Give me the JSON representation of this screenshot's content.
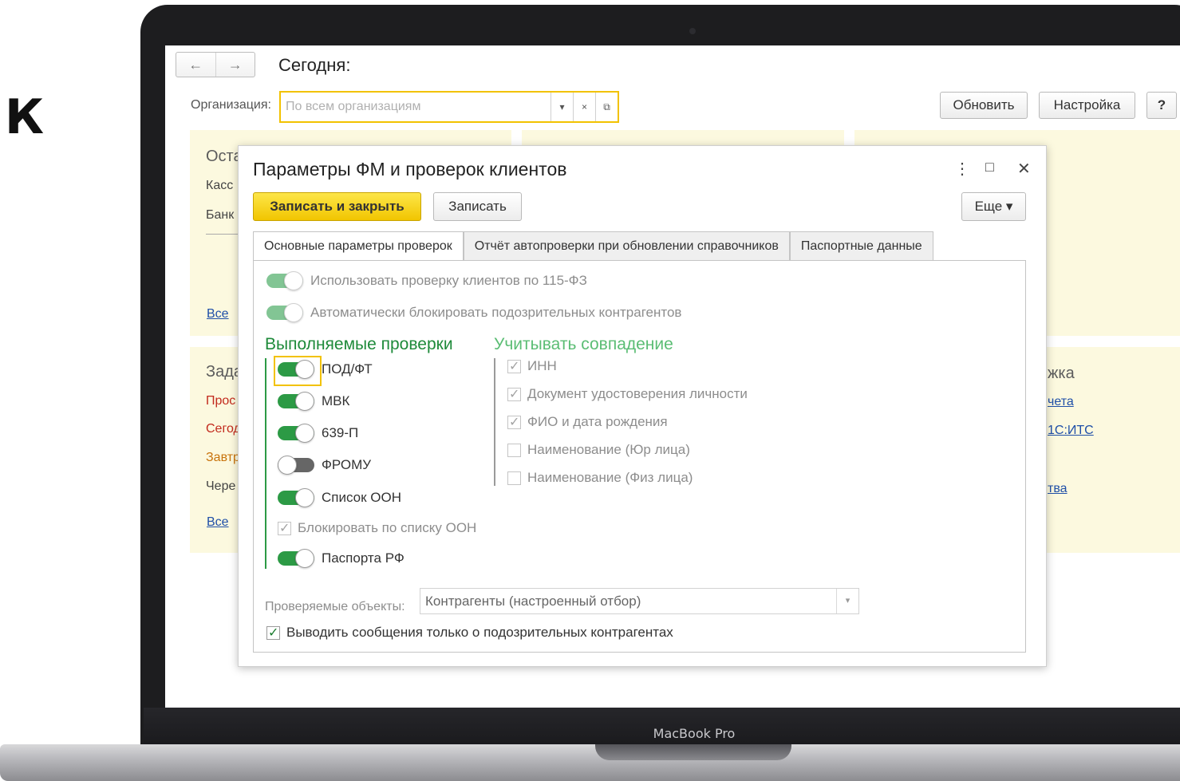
{
  "side_text": "К",
  "device_label": "MacBook Pro",
  "app": {
    "title": "Сегодня:",
    "nav_back": "←",
    "nav_forward": "→",
    "org_label": "Организация:",
    "org_placeholder": "По всем организациям",
    "org_dropdown_glyph": "▾",
    "org_clear_glyph": "×",
    "org_open_glyph": "⧉",
    "refresh_button": "Обновить",
    "settings_button": "Настройка",
    "help_button": "?"
  },
  "background": {
    "left_panel": {
      "heading": "Оста",
      "lines": [
        "Касс",
        "Банк"
      ],
      "link": "Все"
    },
    "tasks_panel": {
      "heading": "Зада",
      "lines": [
        "Прос",
        "Сегод",
        "Завтр",
        "Чере"
      ],
      "link": "Все"
    },
    "right_panel": {
      "heading": "жка",
      "links": [
        "чета",
        "1С:ИТС",
        "тва"
      ]
    }
  },
  "dialog": {
    "title": "Параметры ФМ и проверок клиентов",
    "more_icon": "⋮",
    "maximize_icon": "□",
    "close_icon": "✕",
    "save_close_button": "Записать и закрыть",
    "save_button": "Записать",
    "more_button": "Еще ▾",
    "tabs": [
      {
        "label": "Основные параметры проверок",
        "active": true
      },
      {
        "label": "Отчёт автопроверки при обновлении справочников",
        "active": false
      },
      {
        "label": "Паспортные данные",
        "active": false
      }
    ],
    "use_check_115": {
      "label": "Использовать проверку клиентов по 115-ФЗ",
      "on": true,
      "enabled": false
    },
    "auto_block": {
      "label": "Автоматически блокировать подозрительных контрагентов",
      "on": true,
      "enabled": false
    },
    "checks_heading": "Выполняемые проверки",
    "checks": [
      {
        "label": "ПОД/ФТ",
        "on": true
      },
      {
        "label": "МВК",
        "on": true
      },
      {
        "label": "639-П",
        "on": true
      },
      {
        "label": "ФРОМУ",
        "on": false
      },
      {
        "label": "Список ООН",
        "on": true
      }
    ],
    "block_un_list": {
      "label": "Блокировать по списку ООН",
      "checked": true,
      "enabled": false
    },
    "passports_rf": {
      "label": "Паспорта РФ",
      "on": true
    },
    "match_heading": "Учитывать совпадение",
    "match_items": [
      {
        "label": "ИНН",
        "checked": true
      },
      {
        "label": "Документ удостоверения личности",
        "checked": true
      },
      {
        "label": "ФИО и дата рождения",
        "checked": true
      },
      {
        "label": "Наименование (Юр лица)",
        "checked": false
      },
      {
        "label": "Наименование (Физ лица)",
        "checked": false
      }
    ],
    "objects_label": "Проверяемые объекты:",
    "objects_value": "Контрагенты (настроенный отбор)",
    "objects_arrow": "▾",
    "suspicious_only": {
      "label": "Выводить сообщения только о подозрительных контрагентах",
      "checked": true
    }
  },
  "colors": {
    "accent_yellow": "#f2c200",
    "toggle_green": "#2c9a45",
    "heading_green": "#1e8a3a",
    "heading_green_light": "#5bbd74",
    "panel_bg": "#fcf9df",
    "link_blue": "#1f4fa8"
  }
}
